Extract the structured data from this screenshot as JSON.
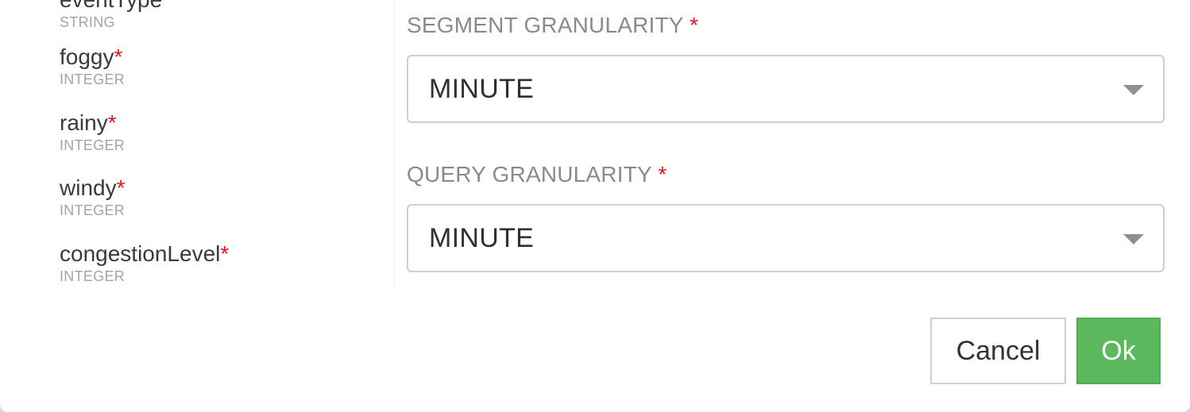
{
  "fields": [
    {
      "name": "eventType",
      "required": "",
      "type": "STRING"
    },
    {
      "name": "foggy",
      "required": "*",
      "type": "INTEGER"
    },
    {
      "name": "rainy",
      "required": "*",
      "type": "INTEGER"
    },
    {
      "name": "windy",
      "required": "*",
      "type": "INTEGER"
    },
    {
      "name": "congestionLevel",
      "required": "*",
      "type": "INTEGER"
    }
  ],
  "segment_granularity": {
    "label": "SEGMENT GRANULARITY",
    "required": "*",
    "value": "MINUTE"
  },
  "query_granularity": {
    "label": "QUERY GRANULARITY",
    "required": "*",
    "value": "MINUTE"
  },
  "buttons": {
    "cancel": "Cancel",
    "ok": "Ok"
  },
  "colors": {
    "required": "#e8141b",
    "ok_button": "#5cb85c"
  }
}
